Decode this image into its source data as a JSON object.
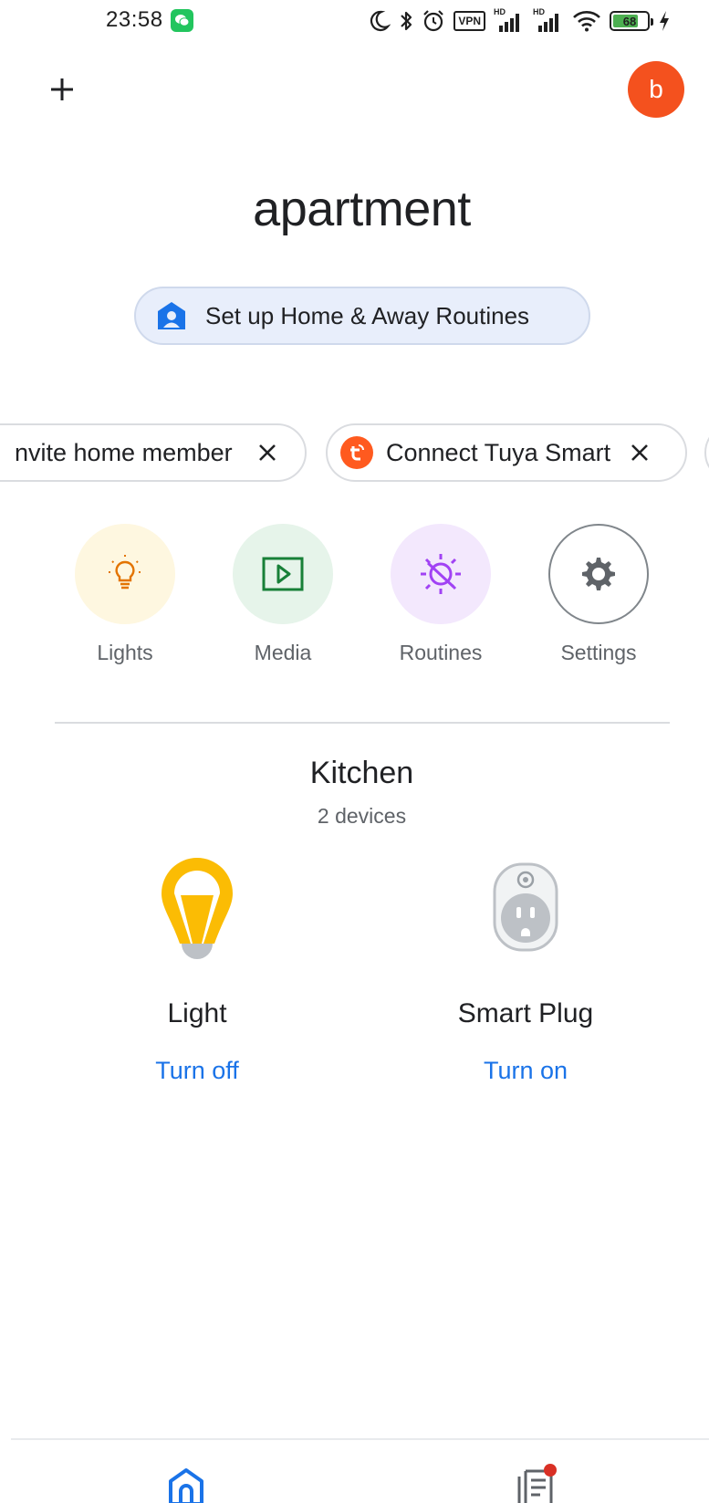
{
  "status_bar": {
    "time": "23:58",
    "vpn_label": "VPN",
    "signal_1_label": "HD",
    "signal_2_label": "HD",
    "battery_level": "68",
    "icons": [
      "wechat-icon",
      "moon-icon",
      "bluetooth-icon",
      "alarm-icon",
      "vpn-icon",
      "signal-icon",
      "wifi-icon",
      "battery-icon",
      "charging-icon"
    ]
  },
  "header": {
    "add_icon": "plus-icon",
    "avatar_letter": "b",
    "avatar_color": "#f4511e"
  },
  "home": {
    "title": "apartment",
    "routine_chip_label": "Set up Home & Away Routines"
  },
  "suggestion_chips": [
    {
      "label": "nvite home member"
    },
    {
      "label": "Connect Tuya Smart"
    }
  ],
  "favorites": [
    {
      "label": "Lights",
      "icon": "lightbulb-icon",
      "bg": "#fef7e0",
      "fg": "#e37400"
    },
    {
      "label": "Media",
      "icon": "play-icon",
      "bg": "#e6f4ea",
      "fg": "#188038"
    },
    {
      "label": "Routines",
      "icon": "routines-icon",
      "bg": "#f3e8fd",
      "fg": "#a142f4"
    },
    {
      "label": "Settings",
      "icon": "gear-icon",
      "bg": "#ffffff",
      "fg": "#5f6368"
    }
  ],
  "room": {
    "name": "Kitchen",
    "device_count": "2 devices",
    "devices": [
      {
        "name": "Light",
        "action": "Turn off",
        "icon": "bulb-icon",
        "state": "on"
      },
      {
        "name": "Smart Plug",
        "action": "Turn on",
        "icon": "plug-icon",
        "state": "off"
      }
    ]
  },
  "bottom_nav": {
    "items": [
      {
        "icon": "home-icon",
        "selected": true
      },
      {
        "icon": "feed-icon",
        "selected": false,
        "badge": true
      }
    ]
  },
  "colors": {
    "accent": "#1a73e8",
    "routine_chip_bg": "#e8eefb",
    "bulb_yellow": "#fbbc04",
    "tuya_orange": "#ff5a1f",
    "badge_red": "#d93025"
  }
}
